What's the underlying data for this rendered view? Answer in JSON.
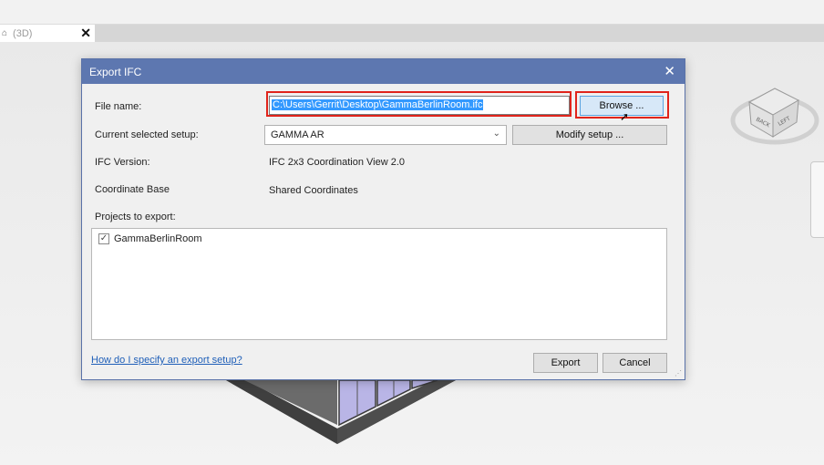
{
  "app": {
    "view_tab_label": "(3D)",
    "view_tab_close": "✕"
  },
  "dialog": {
    "title": "Export IFC",
    "close_glyph": "✕",
    "file_name_label": "File name:",
    "file_name_value": "C:\\Users\\Gerrit\\Desktop\\GammaBerlinRoom.ifc",
    "browse_label": "Browse ...",
    "setup_label": "Current selected setup:",
    "setup_value": "GAMMA AR",
    "modify_setup_label": "Modify setup ...",
    "ifc_version_label": "IFC Version:",
    "ifc_version_value": "IFC 2x3 Coordination View 2.0",
    "coord_base_label": "Coordinate Base",
    "coord_base_value": "Shared Coordinates",
    "projects_label": "Projects to export:",
    "projects": [
      {
        "name": "GammaBerlinRoom",
        "checked": true
      }
    ],
    "help_link": "How do I specify an export setup?",
    "export_label": "Export",
    "cancel_label": "Cancel"
  },
  "navcube": {
    "faces": [
      "BACK",
      "LEFT"
    ]
  },
  "colors": {
    "title_bar": "#5d77b0",
    "highlight_red": "#e0241b",
    "selection_blue": "#3399ff",
    "link_blue": "#1f5fb8"
  }
}
